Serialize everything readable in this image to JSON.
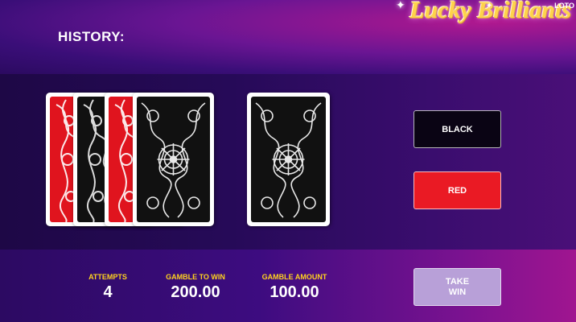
{
  "header": {
    "history_label": "HISTORY:",
    "logo_text": "Lucky Brilliants",
    "logo_small": "LOTO"
  },
  "history_cards": [
    {
      "color": "red"
    },
    {
      "color": "black"
    },
    {
      "color": "red"
    },
    {
      "color": "black"
    }
  ],
  "current_card": {
    "state": "face-down",
    "back": "black"
  },
  "buttons": {
    "black_label": "BLACK",
    "red_label": "RED",
    "take_win_line1": "TAKE",
    "take_win_line2": "WIN"
  },
  "stats": {
    "attempts_label": "ATTEMPTS",
    "attempts_value": "4",
    "gamble_to_win_label": "GAMBLE TO WIN",
    "gamble_to_win_value": "200.00",
    "gamble_amount_label": "GAMBLE AMOUNT",
    "gamble_amount_value": "100.00"
  },
  "colors": {
    "card_red": "#e0141e",
    "card_black": "#111111",
    "label_yellow": "#ffd21e",
    "logo_gold": "#ffd34a"
  }
}
